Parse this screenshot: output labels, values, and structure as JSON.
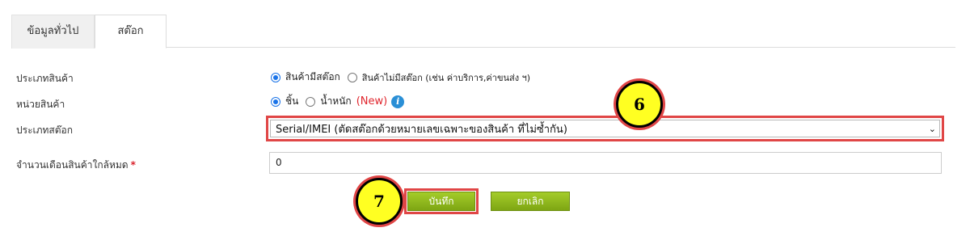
{
  "tabs": [
    {
      "label": "ข้อมูลทั่วไป"
    },
    {
      "label": "สต๊อก"
    }
  ],
  "form": {
    "product_type": {
      "label": "ประเภทสินค้า",
      "options": [
        "สินค้ามีสต๊อก",
        "สินค้าไม่มีสต๊อก (เช่น ค่าบริการ,ค่าขนส่ง ฯ)"
      ],
      "selected": "สินค้ามีสต๊อก"
    },
    "unit": {
      "label": "หน่วยสินค้า",
      "options": [
        "ชิ้น",
        "น้ำหนัก"
      ],
      "selected": "ชิ้น",
      "new_tag": "(New)",
      "info_icon": "i"
    },
    "stock_type": {
      "label": "ประเภทสต๊อก",
      "value": "Serial/IMEI (ตัดสต๊อกด้วยหมายเลขเฉพาะของสินค้า ที่ไม่ซ้ำกัน)",
      "chevron": "⌄"
    },
    "low_stock_months": {
      "label": "จำนวนเดือนสินค้าใกล้หมด",
      "required_mark": "*",
      "value": "0"
    }
  },
  "buttons": {
    "save": "บันทึก",
    "cancel": "ยกเลิก"
  },
  "callouts": [
    "6",
    "7"
  ],
  "colors": {
    "highlight": "#e04646",
    "callout_fill": "#ffff22",
    "button_green": "#8db61c",
    "radio_blue": "#1a73e8",
    "new_red": "#e0262e"
  }
}
